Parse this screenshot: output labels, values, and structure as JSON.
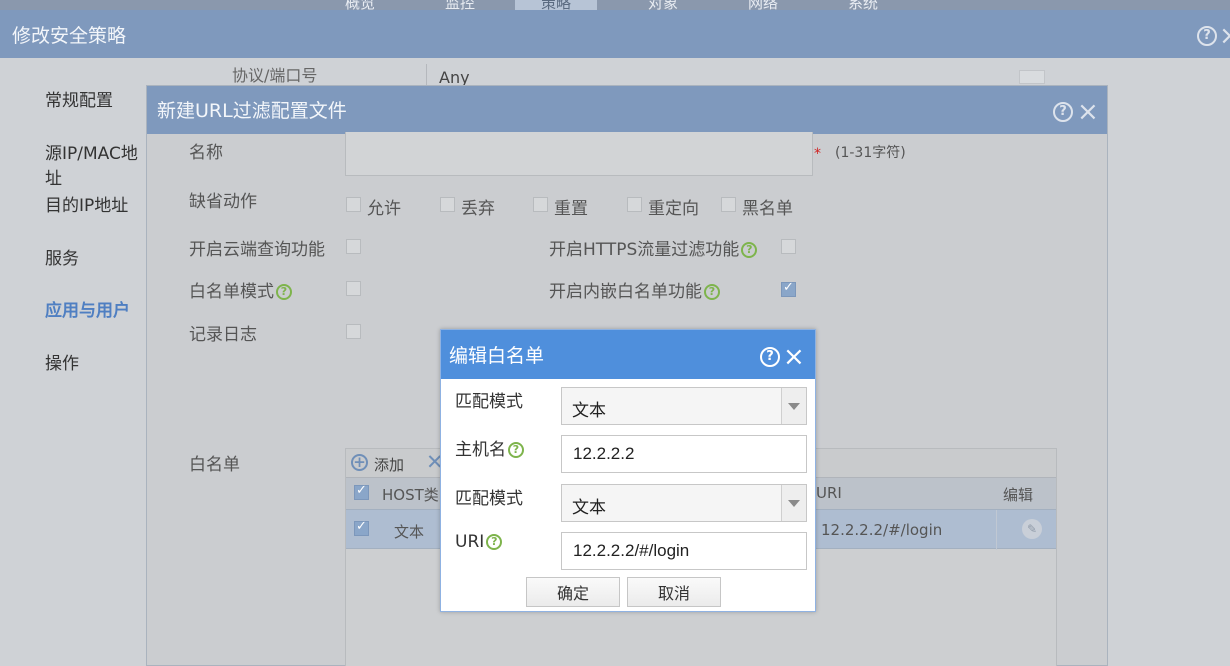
{
  "topnav": {
    "items": [
      "概览",
      "监控",
      "策略",
      "对象",
      "网络",
      "系统"
    ],
    "active_index": 2
  },
  "outer": {
    "title": "修改安全策略",
    "sidebar": [
      "常规配置",
      "源IP/MAC地址",
      "目的IP地址",
      "服务",
      "应用与用户",
      "操作"
    ],
    "sidebar_active_index": 4,
    "field_label": "协议/端口号",
    "field_value": "Any"
  },
  "mid": {
    "title": "新建URL过滤配置文件",
    "name_label": "名称",
    "name_hint": "(1-31字符)",
    "default_action_label": "缺省动作",
    "default_actions": [
      "允许",
      "丢弃",
      "重置",
      "重定向",
      "黑名单"
    ],
    "cloud_query_label": "开启云端查询功能",
    "https_filter_label": "开启HTTPS流量过滤功能",
    "whitelist_mode_label": "白名单模式",
    "builtin_whitelist_label": "开启内嵌白名单功能",
    "builtin_whitelist_checked": true,
    "log_label": "记录日志",
    "whitelist_label": "白名单",
    "table": {
      "add_label": "添加",
      "columns": [
        "HOST类",
        "URI",
        "编辑"
      ],
      "rows": [
        {
          "host_type": "文本",
          "uri": "12.2.2.2/#/login",
          "checked": true
        }
      ]
    }
  },
  "dialog": {
    "title": "编辑白名单",
    "match_mode_label": "匹配模式",
    "match_mode_value": "文本",
    "hostname_label": "主机名",
    "hostname_value": "12.2.2.2",
    "match_mode2_label": "匹配模式",
    "match_mode2_value": "文本",
    "uri_label": "URI",
    "uri_value": "12.2.2.2/#/login",
    "ok_label": "确定",
    "cancel_label": "取消"
  }
}
